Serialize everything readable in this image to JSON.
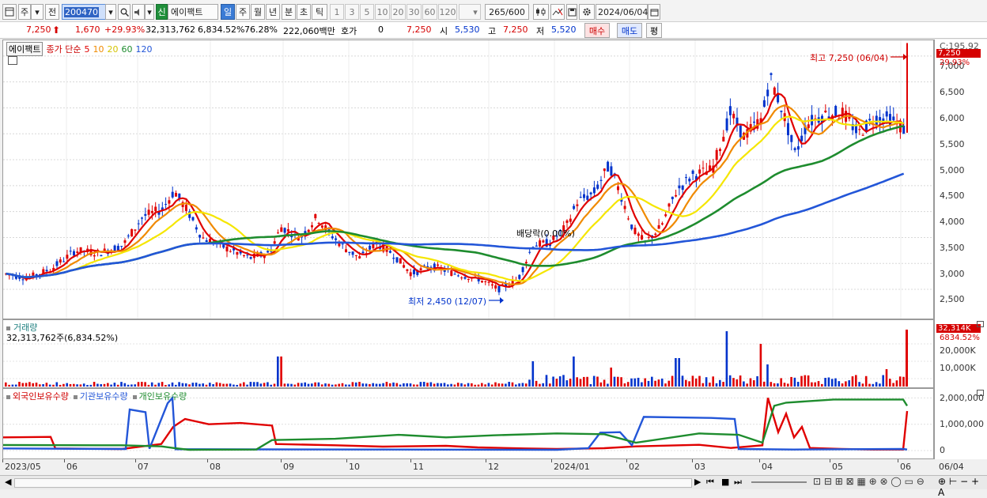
{
  "toolbar": {
    "period_btn": "주",
    "prev_btn": "전",
    "code_input": "200470",
    "market_badge": "신",
    "stock_name": "에이팩트",
    "timeframes": [
      "일",
      "주",
      "월",
      "년",
      "분",
      "초",
      "틱"
    ],
    "intervals": [
      "1",
      "3",
      "5",
      "10",
      "20",
      "30",
      "60",
      "120"
    ],
    "count": "265",
    "count_total": "/600",
    "date": "2024/06/04"
  },
  "info": {
    "price": "7,250",
    "change": "1,670",
    "change_pct": "+29.93%",
    "volume": "32,313,762",
    "volume_pct": "6,834.52%",
    "turnover_pct": "76.28%",
    "amount": "222,060백만",
    "quote_label": "호가",
    "quote_val": "0",
    "quote_price": "7,250",
    "open_label": "시",
    "open": "5,530",
    "high_label": "고",
    "high": "7,250",
    "low_label": "저",
    "low": "5,520",
    "buy_btn": "매수",
    "sell_btn": "매도",
    "eval_btn": "평"
  },
  "main_panel": {
    "legend_name": "에이팩트",
    "legend_ma_label": "종가 단순",
    "ma_periods": [
      "5",
      "10",
      "20",
      "60",
      "120"
    ],
    "ma_colors": [
      "#e00000",
      "#f08a00",
      "#f5e600",
      "#1e8c2e",
      "#2356d8"
    ],
    "y_ticks": [
      "7,000",
      "6,500",
      "6,000",
      "5,500",
      "5,000",
      "4,500",
      "4,000",
      "3,500",
      "3,000",
      "2,500"
    ],
    "axis_top_note": "C:195.92",
    "price_tag": "7,250",
    "pct_tag": "29.93%",
    "high_annot": "최고 7,250 (06/04)",
    "low_annot": "최저 2,450 (12/07)",
    "dividend_annot": "배당락(0.00%)"
  },
  "volume_panel": {
    "title": "거래량",
    "value": "32,313,762주(6,834.52%)",
    "y_ticks": [
      "20,000K",
      "10,000K"
    ],
    "tag_value": "32,314K",
    "tag_pct": "6834.52%"
  },
  "holding_panel": {
    "series": [
      "외국인보유수량",
      "기관보유수량",
      "개인보유수량"
    ],
    "series_colors": [
      "#e00000",
      "#2356d8",
      "#1e8c2e"
    ],
    "y_ticks": [
      "2,000,000",
      "1,000,000",
      "0"
    ]
  },
  "x_axis": [
    "2023/05",
    "06",
    "07",
    "08",
    "09",
    "10",
    "11",
    "12",
    "2024/01",
    "02",
    "03",
    "04",
    "05",
    "06"
  ],
  "x_axis_last": "06/04"
}
